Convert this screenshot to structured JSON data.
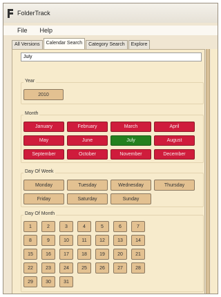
{
  "window": {
    "title": "FolderTrack"
  },
  "menu": [
    "File",
    "Help"
  ],
  "tabs": [
    {
      "label": "All Versions",
      "active": false
    },
    {
      "label": "Calendar Search",
      "active": true
    },
    {
      "label": "Category Search",
      "active": false
    },
    {
      "label": "Explore",
      "active": false
    }
  ],
  "search": {
    "value": "July"
  },
  "year": {
    "label": "Year",
    "values": [
      "2010"
    ]
  },
  "month": {
    "label": "Month",
    "values": [
      "January",
      "February",
      "March",
      "April",
      "May",
      "June",
      "July",
      "August",
      "September",
      "October",
      "November",
      "December"
    ],
    "selected": "July"
  },
  "weekday": {
    "label": "Day Of Week",
    "values": [
      "Monday",
      "Tuesday",
      "Wednesday",
      "Thursday",
      "Friday",
      "Saturday",
      "Sunday"
    ]
  },
  "day_of_month": {
    "label": "Day Of Month",
    "values": [
      "1",
      "2",
      "3",
      "4",
      "5",
      "6",
      "7",
      "8",
      "9",
      "10",
      "11",
      "12",
      "13",
      "14",
      "15",
      "16",
      "17",
      "18",
      "19",
      "20",
      "21",
      "22",
      "23",
      "24",
      "25",
      "26",
      "27",
      "28",
      "29",
      "30",
      "31"
    ]
  },
  "colors": {
    "selected": "#23801f",
    "month_button": "#cf1c3c",
    "button": "#e3c191",
    "panel": "#f7ebcc"
  }
}
